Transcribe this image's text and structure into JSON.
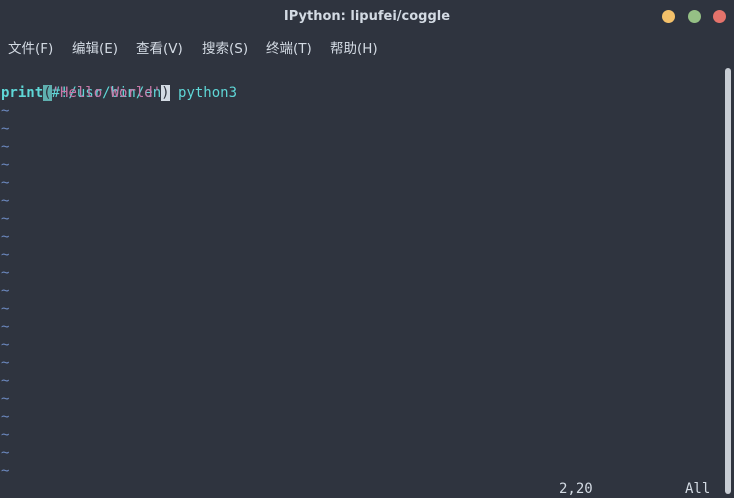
{
  "window": {
    "title": "IPython: lipufei/coggle",
    "buttons": {
      "minimize_color": "#f4c16a",
      "maximize_color": "#95c085",
      "close_color": "#e5736b"
    }
  },
  "menu": {
    "items": [
      {
        "label": "文件(F)"
      },
      {
        "label": "编辑(E)"
      },
      {
        "label": "查看(V)"
      },
      {
        "label": "搜索(S)"
      },
      {
        "label": "终端(T)"
      },
      {
        "label": "帮助(H)"
      }
    ]
  },
  "editor": {
    "shebang": "#!/usr/bin/env python3",
    "line2": {
      "func": "print",
      "open_paren": "(",
      "string": "'Hello World'",
      "close_paren": ")"
    },
    "empty_line_marker": "~",
    "empty_line_count": 21,
    "status": {
      "position": "2,20",
      "scroll": "All"
    }
  },
  "colors": {
    "background": "#2f343f",
    "text": "#d3dae3",
    "keyword": "#5fd7d7",
    "string": "#c678a8",
    "tilde": "#6c89c0"
  }
}
